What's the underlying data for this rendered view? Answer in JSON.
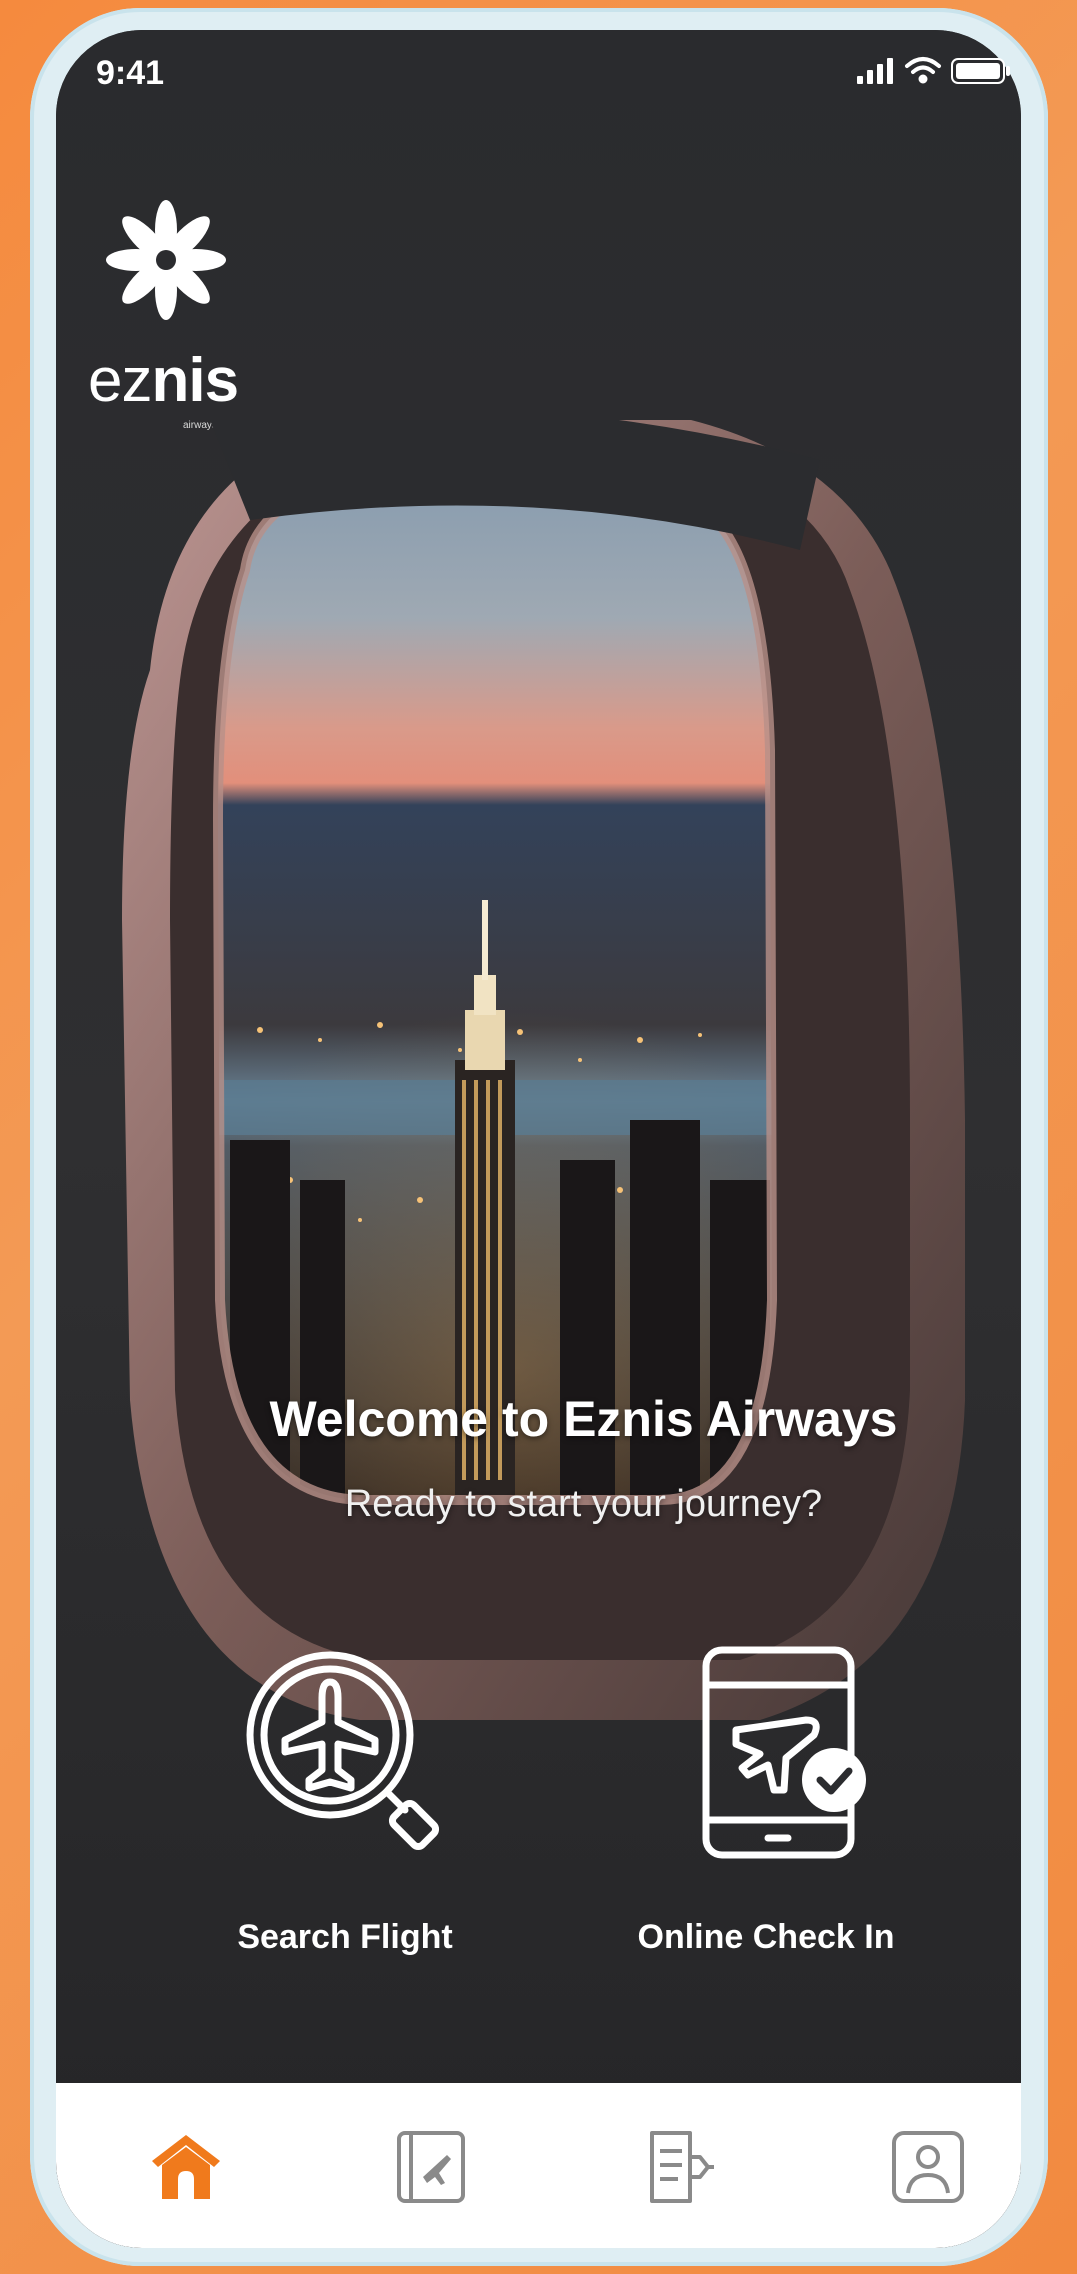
{
  "status_bar": {
    "time": "9:41",
    "icons": [
      "signal-icon",
      "wifi-icon",
      "battery-icon"
    ]
  },
  "brand": {
    "name_light": "ez",
    "name_bold": "nis",
    "tagline": "airways",
    "logo_icon": "flower-star-logo"
  },
  "hero": {
    "title": "Welcome to Eznis Airways",
    "subtitle": "Ready to start your journey?"
  },
  "actions": [
    {
      "label": "Search Flight",
      "icon": "search-flight-icon"
    },
    {
      "label": "Online Check In",
      "icon": "online-check-in-icon"
    }
  ],
  "tab_bar": {
    "items": [
      {
        "icon": "home-icon",
        "active": true
      },
      {
        "icon": "boarding-pass-icon",
        "active": false
      },
      {
        "icon": "itinerary-icon",
        "active": false
      },
      {
        "icon": "profile-icon",
        "active": false
      }
    ]
  },
  "colors": {
    "accent": "#f07a1c",
    "background": "#f58a3e",
    "screen": "#2b2c2f",
    "tab_inactive": "#8a8a8a"
  }
}
